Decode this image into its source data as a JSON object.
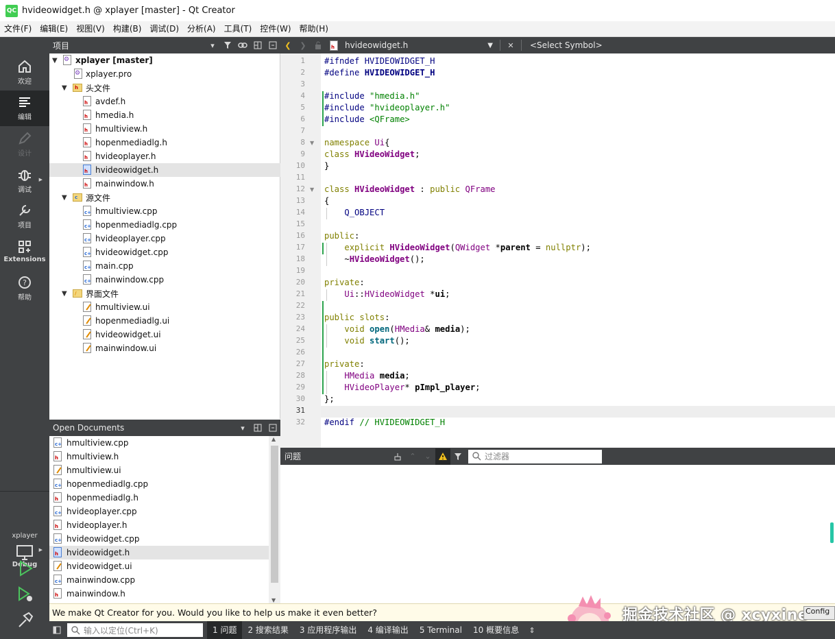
{
  "window": {
    "title": "hvideowidget.h @ xplayer [master] - Qt Creator",
    "logo": "QC"
  },
  "menu": [
    "文件(F)",
    "编辑(E)",
    "视图(V)",
    "构建(B)",
    "调试(D)",
    "分析(A)",
    "工具(T)",
    "控件(W)",
    "帮助(H)"
  ],
  "modes": [
    {
      "label": "欢迎",
      "icon": "home-icon",
      "state": "normal"
    },
    {
      "label": "编辑",
      "icon": "edit-lines-icon",
      "state": "active"
    },
    {
      "label": "设计",
      "icon": "pen-icon",
      "state": "disabled"
    },
    {
      "label": "调试",
      "icon": "bug-icon",
      "state": "normal"
    },
    {
      "label": "项目",
      "icon": "wrench-icon",
      "state": "normal"
    },
    {
      "label": "Extensions",
      "icon": "extensions-icon",
      "state": "normal"
    },
    {
      "label": "帮助",
      "icon": "help-icon",
      "state": "normal"
    }
  ],
  "kit": {
    "project": "xplayer",
    "build": "Debug"
  },
  "project_pane": {
    "title": "项目",
    "tree": [
      {
        "label": "xplayer [master]",
        "kind": "project",
        "level": 0,
        "expanded": true
      },
      {
        "label": "xplayer.pro",
        "kind": "pro",
        "level": 1
      },
      {
        "label": "头文件",
        "kind": "folder-h",
        "level": 1,
        "expanded": true
      },
      {
        "label": "avdef.h",
        "kind": "h",
        "level": 2
      },
      {
        "label": "hmedia.h",
        "kind": "h",
        "level": 2
      },
      {
        "label": "hmultiview.h",
        "kind": "h",
        "level": 2
      },
      {
        "label": "hopenmediadlg.h",
        "kind": "h",
        "level": 2
      },
      {
        "label": "hvideoplayer.h",
        "kind": "h",
        "level": 2
      },
      {
        "label": "hvideowidget.h",
        "kind": "h",
        "level": 2,
        "selected": true
      },
      {
        "label": "mainwindow.h",
        "kind": "h",
        "level": 2
      },
      {
        "label": "源文件",
        "kind": "folder-cpp",
        "level": 1,
        "expanded": true
      },
      {
        "label": "hmultiview.cpp",
        "kind": "cpp",
        "level": 2
      },
      {
        "label": "hopenmediadlg.cpp",
        "kind": "cpp",
        "level": 2
      },
      {
        "label": "hvideoplayer.cpp",
        "kind": "cpp",
        "level": 2
      },
      {
        "label": "hvideowidget.cpp",
        "kind": "cpp",
        "level": 2
      },
      {
        "label": "main.cpp",
        "kind": "cpp",
        "level": 2
      },
      {
        "label": "mainwindow.cpp",
        "kind": "cpp",
        "level": 2
      },
      {
        "label": "界面文件",
        "kind": "folder-ui",
        "level": 1,
        "expanded": true
      },
      {
        "label": "hmultiview.ui",
        "kind": "ui",
        "level": 2
      },
      {
        "label": "hopenmediadlg.ui",
        "kind": "ui",
        "level": 2
      },
      {
        "label": "hvideowidget.ui",
        "kind": "ui",
        "level": 2
      },
      {
        "label": "mainwindow.ui",
        "kind": "ui",
        "level": 2
      }
    ]
  },
  "open_documents": {
    "title": "Open Documents",
    "items": [
      {
        "label": "hmultiview.cpp",
        "kind": "cpp"
      },
      {
        "label": "hmultiview.h",
        "kind": "h"
      },
      {
        "label": "hmultiview.ui",
        "kind": "ui"
      },
      {
        "label": "hopenmediadlg.cpp",
        "kind": "cpp"
      },
      {
        "label": "hopenmediadlg.h",
        "kind": "h"
      },
      {
        "label": "hvideoplayer.cpp",
        "kind": "cpp"
      },
      {
        "label": "hvideoplayer.h",
        "kind": "h"
      },
      {
        "label": "hvideowidget.cpp",
        "kind": "cpp"
      },
      {
        "label": "hvideowidget.h",
        "kind": "h",
        "selected": true
      },
      {
        "label": "hvideowidget.ui",
        "kind": "ui"
      },
      {
        "label": "mainwindow.cpp",
        "kind": "cpp"
      },
      {
        "label": "mainwindow.h",
        "kind": "h"
      }
    ]
  },
  "editor": {
    "current_file": "hvideowidget.h",
    "symbol": "<Select Symbol>",
    "current_line": 31,
    "lines": [
      [
        [
          "pp",
          "#ifndef "
        ],
        [
          "mac",
          "HVIDEOWIDGET_H"
        ]
      ],
      [
        [
          "pp",
          "#define "
        ],
        [
          "mac bld",
          "HVIDEOWIDGET_H"
        ]
      ],
      [],
      [
        [
          "pp",
          "#include "
        ],
        [
          "str",
          "\"hmedia.h\""
        ]
      ],
      [
        [
          "pp",
          "#include "
        ],
        [
          "str",
          "\"hvideoplayer.h\""
        ]
      ],
      [
        [
          "pp",
          "#include "
        ],
        [
          "str",
          "<QFrame>"
        ]
      ],
      [],
      [
        [
          "kw",
          "namespace "
        ],
        [
          "ty",
          "Ui"
        ],
        [
          "",
          "{"
        ]
      ],
      [
        [
          "kw",
          "class "
        ],
        [
          "ty bld",
          "HVideoWidget"
        ],
        [
          "",
          ";"
        ]
      ],
      [
        [
          "",
          "}"
        ]
      ],
      [],
      [
        [
          "kw",
          "class "
        ],
        [
          "ty bld",
          "HVideoWidget"
        ],
        [
          "",
          " : "
        ],
        [
          "kw",
          "public "
        ],
        [
          "ty",
          "QFrame"
        ]
      ],
      [
        [
          "",
          "{"
        ]
      ],
      [
        [
          "",
          "    "
        ],
        [
          "mac",
          "Q_OBJECT"
        ]
      ],
      [],
      [
        [
          "kw",
          "public"
        ],
        [
          "",
          ":"
        ]
      ],
      [
        [
          "",
          "    "
        ],
        [
          "kw",
          "explicit "
        ],
        [
          "ty bld",
          "HVideoWidget"
        ],
        [
          "",
          "("
        ],
        [
          "ty",
          "QWidget"
        ],
        [
          "",
          " *"
        ],
        [
          "bld",
          "parent"
        ],
        [
          "",
          " = "
        ],
        [
          "kw",
          "nullptr"
        ],
        [
          "",
          ");"
        ]
      ],
      [
        [
          "",
          "    ~"
        ],
        [
          "ty bld",
          "HVideoWidget"
        ],
        [
          "",
          "();"
        ]
      ],
      [],
      [
        [
          "kw",
          "private"
        ],
        [
          "",
          ":"
        ]
      ],
      [
        [
          "",
          "    "
        ],
        [
          "ty",
          "Ui"
        ],
        [
          "",
          "::"
        ],
        [
          "ty",
          "HVideoWidget"
        ],
        [
          "",
          " *"
        ],
        [
          "bld",
          "ui"
        ],
        [
          "",
          ";"
        ]
      ],
      [],
      [
        [
          "kw",
          "public slots"
        ],
        [
          "",
          ":"
        ]
      ],
      [
        [
          "",
          "    "
        ],
        [
          "kw",
          "void "
        ],
        [
          "fn",
          "open"
        ],
        [
          "",
          "("
        ],
        [
          "ty",
          "HMedia"
        ],
        [
          "",
          "& "
        ],
        [
          "bld",
          "media"
        ],
        [
          "",
          ");"
        ]
      ],
      [
        [
          "",
          "    "
        ],
        [
          "kw",
          "void "
        ],
        [
          "fn",
          "start"
        ],
        [
          "",
          "();"
        ]
      ],
      [],
      [
        [
          "kw",
          "private"
        ],
        [
          "",
          ":"
        ]
      ],
      [
        [
          "",
          "    "
        ],
        [
          "ty",
          "HMedia"
        ],
        [
          "",
          " "
        ],
        [
          "bld",
          "media"
        ],
        [
          "",
          ";"
        ]
      ],
      [
        [
          "",
          "    "
        ],
        [
          "ty",
          "HVideoPlayer"
        ],
        [
          "",
          "* "
        ],
        [
          "bld",
          "pImpl_player"
        ],
        [
          "",
          ";"
        ]
      ],
      [
        [
          "",
          "};"
        ]
      ],
      [],
      [
        [
          "pp",
          "#endif "
        ],
        [
          "cm",
          "// HVIDEOWIDGET_H"
        ]
      ]
    ]
  },
  "issues": {
    "title": "问题",
    "filter_placeholder": "过滤器"
  },
  "info_bar": {
    "message": "We make Qt Creator for you. Would you like to help us make it even better?",
    "button": "Config"
  },
  "watermark": "掘金技术社区 @ xcyxine",
  "status_bar": {
    "locator_placeholder": "输入以定位(Ctrl+K)",
    "tabs": [
      "1  问题",
      "2  搜索结果",
      "3  应用程序输出",
      "4  编译输出",
      "5  Terminal",
      "10  概要信息"
    ]
  },
  "colors": {
    "dark_panel": "#404244",
    "active_mode": "#262829",
    "change_marker": "#2da44e",
    "keyword": "#808000",
    "type": "#800080",
    "string": "#008000"
  }
}
